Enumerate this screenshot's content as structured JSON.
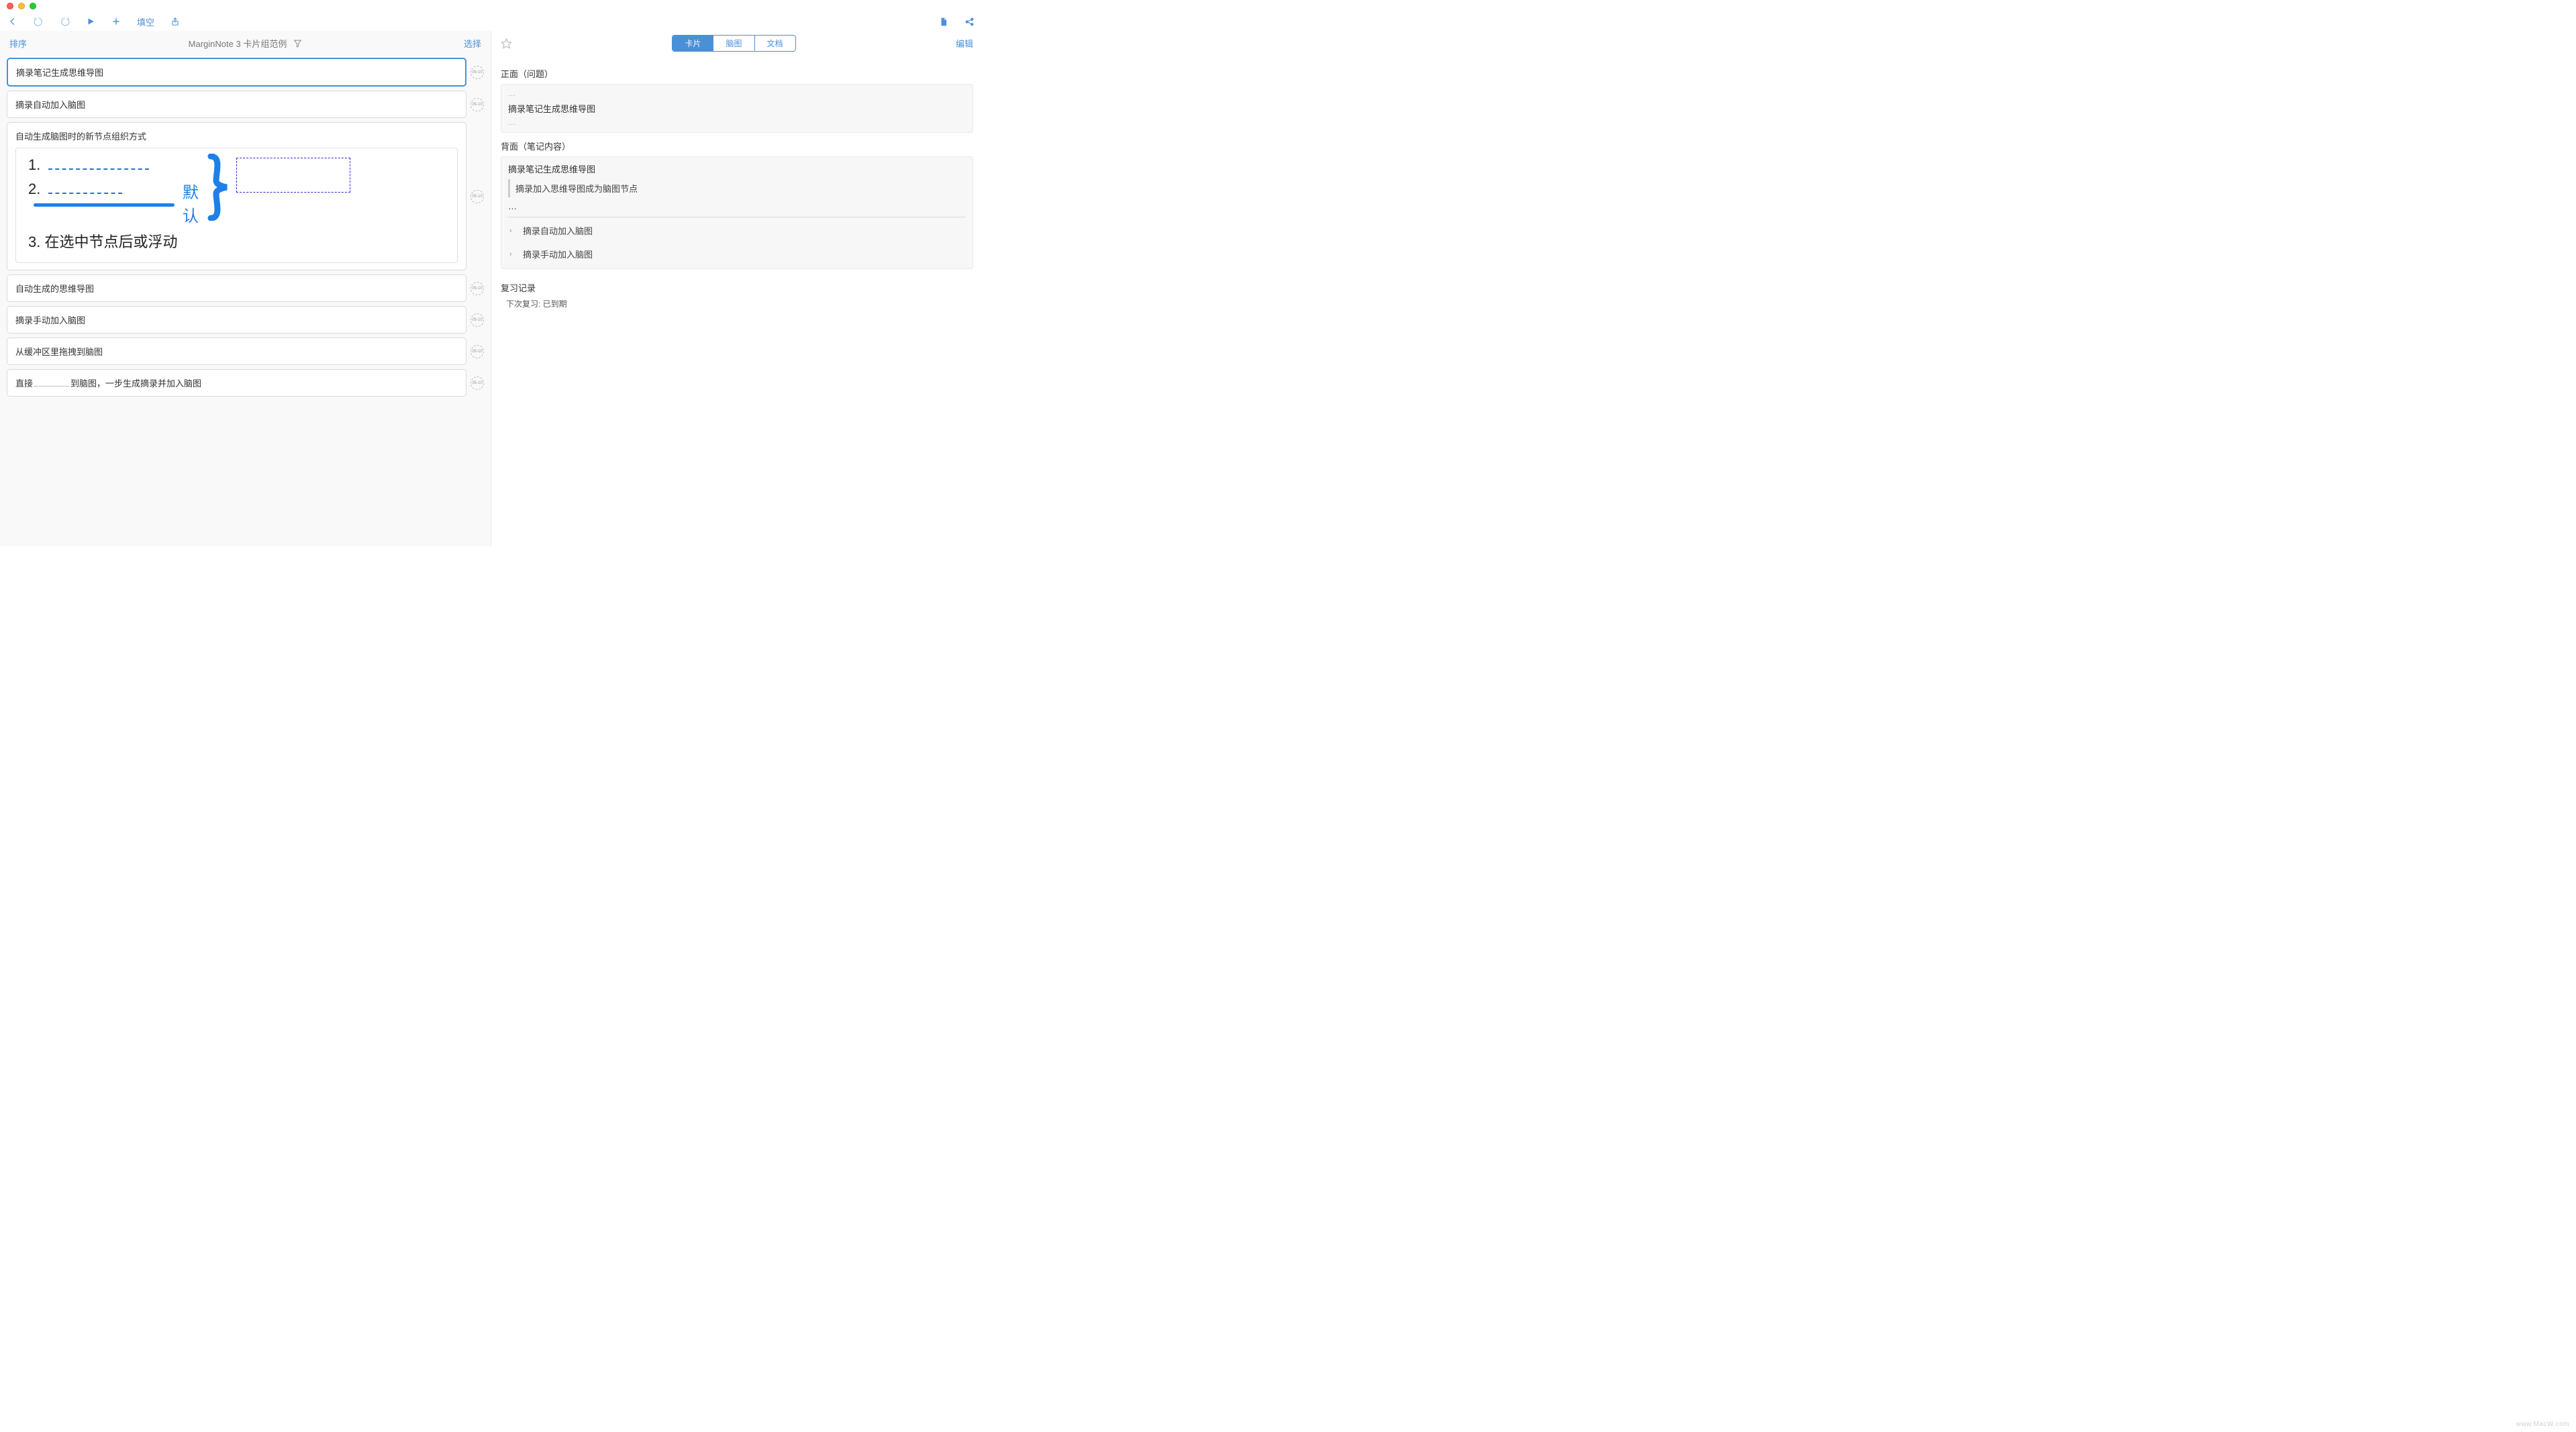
{
  "toolbar": {
    "fillblank_label": "填空"
  },
  "left": {
    "sort_label": "排序",
    "title": "MarginNote 3 卡片组范例",
    "select_label": "选择",
    "date_badge": "05-10",
    "cards": {
      "c0": "摘录笔记生成思维导图",
      "c1": "摘录自动加入脑图",
      "c2_title": "自动生成脑图时的新节点组织方式",
      "c2_default": "默认",
      "c2_item3": "3.  在选中节点后或浮动",
      "c3": "自动生成的思维导图",
      "c4": "摘录手动加入脑图",
      "c5": "从缓冲区里拖拽到脑图",
      "c6_pre": "直接",
      "c6_post": "到脑图，一步生成摘录并加入脑图"
    }
  },
  "right": {
    "tabs": {
      "card": "卡片",
      "mindmap": "脑图",
      "document": "文档"
    },
    "edit_label": "编辑",
    "front_label": "正面（问题）",
    "front_text": "摘录笔记生成思维导图",
    "back_label": "背面（笔记内容）",
    "back_title": "摘录笔记生成思维导图",
    "back_quote": "摘录加入思维导图成为脑图节点",
    "link1": "摘录自动加入脑图",
    "link2": "摘录手动加入脑图",
    "review_section": "复习记录",
    "review_text": "下次复习: 已到期"
  },
  "watermark": "www.MacW.com"
}
